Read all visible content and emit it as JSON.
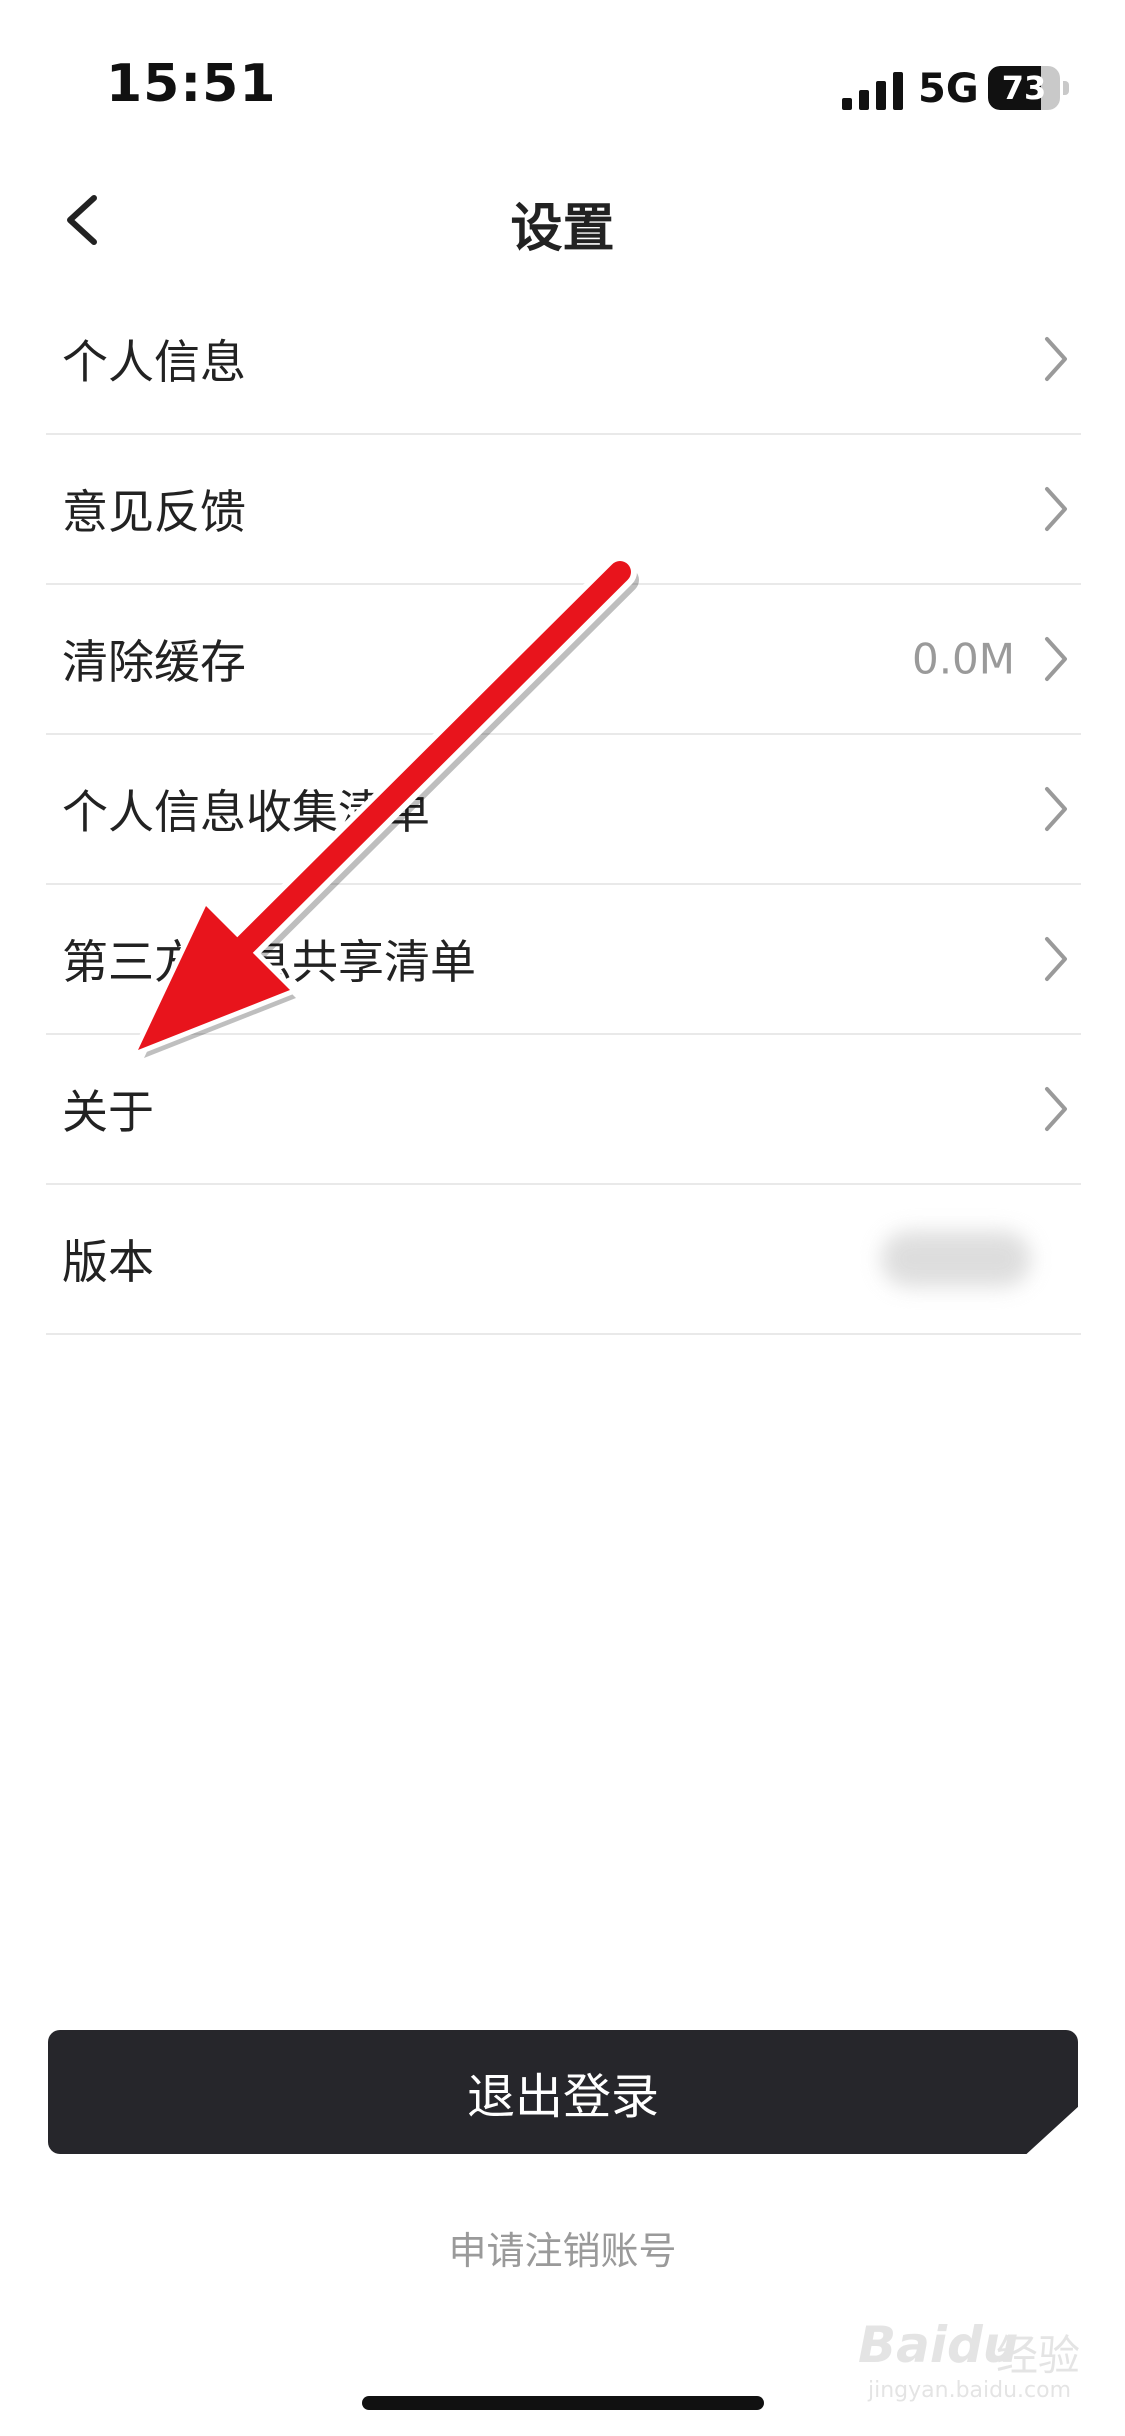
{
  "status_bar": {
    "time": "15:51",
    "network": "5G",
    "battery_percent": "73",
    "battery_level": 0.73,
    "signal_icon": "signal-bars-icon"
  },
  "nav": {
    "title": "设置",
    "back_icon": "chevron-left-icon"
  },
  "settings": {
    "items": [
      {
        "label": "个人信息",
        "value": "",
        "chevron": true
      },
      {
        "label": "意见反馈",
        "value": "",
        "chevron": true
      },
      {
        "label": "清除缓存",
        "value": "0.0M",
        "chevron": true
      },
      {
        "label": "个人信息收集清单",
        "value": "",
        "chevron": true
      },
      {
        "label": "第三方信息共享清单",
        "value": "",
        "chevron": true
      },
      {
        "label": "关于",
        "value": "",
        "chevron": true
      },
      {
        "label": "版本",
        "value": "",
        "chevron": false
      }
    ]
  },
  "bottom": {
    "logout_label": "退出登录",
    "cancel_account_label": "申请注销账号"
  },
  "annotation": {
    "arrow_color": "#e8141c"
  },
  "watermark": {
    "brand": "Baidu",
    "cn": "经验",
    "url": "jingyan.baidu.com"
  },
  "colors": {
    "button_bg": "#26262b",
    "divider": "#e9e9e9",
    "muted_text": "#9a9a9a"
  }
}
